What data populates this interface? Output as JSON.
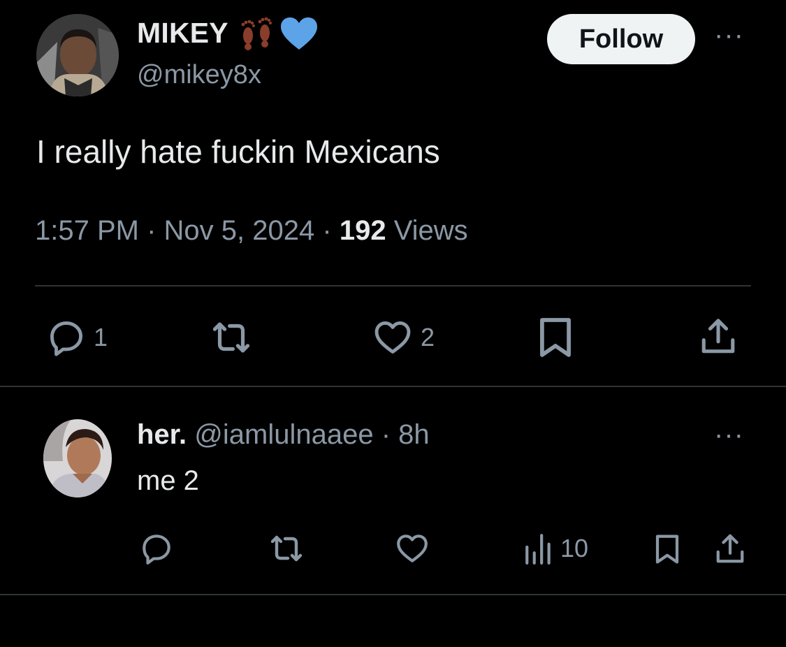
{
  "tweet": {
    "display_name": "MIKEY",
    "handle": "@mikey8x",
    "follow_label": "Follow",
    "text": "I really hate fuckin Mexicans",
    "time": "1:57 PM",
    "date": "Nov 5, 2024",
    "views_count": "192",
    "views_label": "Views",
    "separator": "·",
    "more": "···",
    "stats": {
      "replies": "1",
      "likes": "2"
    },
    "icons": [
      "avatar",
      "footprints-emoji",
      "blue-heart-emoji",
      "reply-icon",
      "retweet-icon",
      "like-icon",
      "bookmark-icon",
      "share-icon",
      "more-icon"
    ]
  },
  "reply": {
    "display_name": "her.",
    "handle": "@iamlulnaaee",
    "separator": "·",
    "age": "8h",
    "text": "me 2",
    "more": "···",
    "stats": {
      "views": "10"
    },
    "icons": [
      "avatar",
      "reply-icon",
      "retweet-icon",
      "like-icon",
      "analytics-icon",
      "bookmark-icon",
      "share-icon",
      "more-icon"
    ]
  },
  "colors": {
    "background": "#000000",
    "text_primary": "#e7e9ea",
    "text_secondary": "#8b98a5",
    "divider": "#2f3336",
    "follow_bg": "#eff3f4",
    "heart_blue": "#5da3e8",
    "footprint_brown": "#8a3d2a"
  }
}
